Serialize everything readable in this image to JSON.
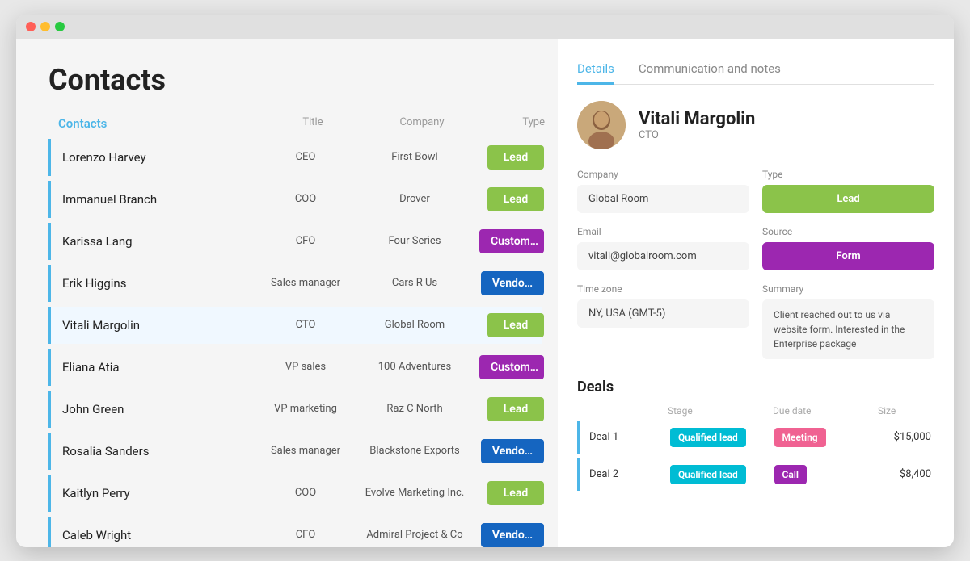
{
  "window": {
    "title": "Contacts"
  },
  "left": {
    "page_title": "Contacts",
    "table_headers": {
      "contacts": "Contacts",
      "title": "Title",
      "company": "Company",
      "type": "Type"
    },
    "contacts": [
      {
        "name": "Lorenzo Harvey",
        "title": "CEO",
        "company": "First Bowl",
        "type": "Lead",
        "type_class": "type-lead"
      },
      {
        "name": "Immanuel Branch",
        "title": "COO",
        "company": "Drover",
        "type": "Lead",
        "type_class": "type-lead"
      },
      {
        "name": "Karissa Lang",
        "title": "CFO",
        "company": "Four Series",
        "type": "Custom…",
        "type_class": "type-customer"
      },
      {
        "name": "Erik Higgins",
        "title": "Sales manager",
        "company": "Cars R Us",
        "type": "Vendo…",
        "type_class": "type-vendor"
      },
      {
        "name": "Vitali Margolin",
        "title": "CTO",
        "company": "Global Room",
        "type": "Lead",
        "type_class": "type-lead",
        "active": true
      },
      {
        "name": "Eliana Atia",
        "title": "VP sales",
        "company": "100 Adventures",
        "type": "Custom…",
        "type_class": "type-customer"
      },
      {
        "name": "John Green",
        "title": "VP marketing",
        "company": "Raz C North",
        "type": "Lead",
        "type_class": "type-lead"
      },
      {
        "name": "Rosalia Sanders",
        "title": "Sales manager",
        "company": "Blackstone Exports",
        "type": "Vendo…",
        "type_class": "type-vendor"
      },
      {
        "name": "Kaitlyn Perry",
        "title": "COO",
        "company": "Evolve Marketing Inc.",
        "type": "Lead",
        "type_class": "type-lead"
      },
      {
        "name": "Caleb Wright",
        "title": "CFO",
        "company": "Admiral Project & Co",
        "type": "Vendo…",
        "type_class": "type-vendor"
      }
    ]
  },
  "right": {
    "tabs": [
      "Details",
      "Communication and notes"
    ],
    "active_tab": "Details",
    "profile": {
      "name": "Vitali Margolin",
      "role": "CTO"
    },
    "details": {
      "company_label": "Company",
      "company_value": "Global Room",
      "type_label": "Type",
      "type_value": "Lead",
      "email_label": "Email",
      "email_value": "vitali@globalroom.com",
      "source_label": "Source",
      "source_value": "Form",
      "timezone_label": "Time zone",
      "timezone_value": "NY, USA (GMT-5)",
      "summary_label": "Summary",
      "summary_value": "Client reached out to us via website form. Interested in the Enterprise package"
    },
    "deals": {
      "title": "Deals",
      "headers": [
        "",
        "Stage",
        "Due date",
        "Size"
      ],
      "rows": [
        {
          "name": "Deal 1",
          "stage": "Qualified lead",
          "stage_class": "badge-qualified",
          "due": "Meeting",
          "due_class": "badge-meeting",
          "size": "$15,000"
        },
        {
          "name": "Deal 2",
          "stage": "Qualified lead",
          "stage_class": "badge-qualified",
          "due": "Call",
          "due_class": "badge-call",
          "size": "$8,400"
        }
      ]
    }
  }
}
